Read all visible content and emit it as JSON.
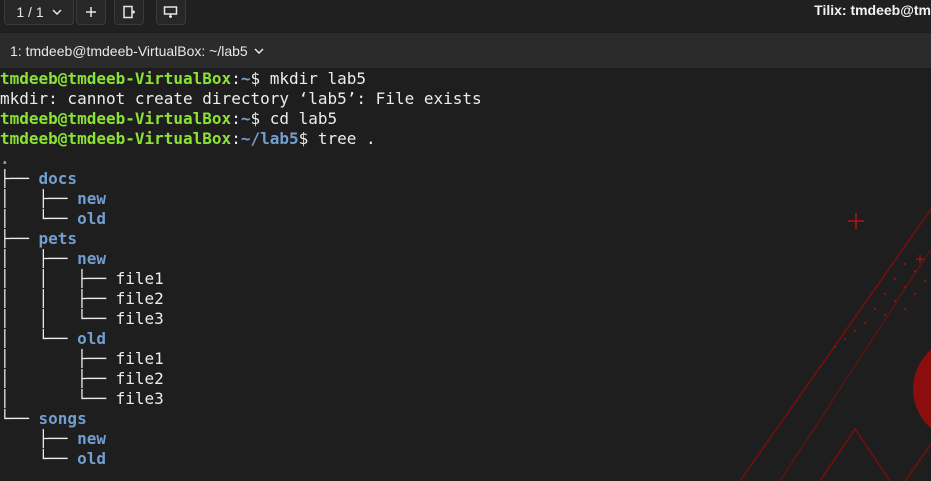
{
  "toolbar": {
    "pager": "1 / 1",
    "app_title": "Tilix: tmdeeb@tm"
  },
  "tab": {
    "label": "1: tmdeeb@tmdeeb-VirtualBox: ~/lab5"
  },
  "terminal": {
    "prompt_user": "tmdeeb@tmdeeb-VirtualBox",
    "lines": [
      {
        "path": "~",
        "cmd": "mkdir lab5"
      },
      {
        "output": "mkdir: cannot create directory ‘lab5’: File exists"
      },
      {
        "path": "~",
        "cmd": "cd lab5"
      },
      {
        "path": "~/lab5",
        "cmd": "tree ."
      }
    ],
    "tree": [
      {
        "branch": "",
        "name": ".",
        "dir": true
      },
      {
        "branch": "├── ",
        "name": "docs",
        "dir": true
      },
      {
        "branch": "│   ├── ",
        "name": "new",
        "dir": true
      },
      {
        "branch": "│   └── ",
        "name": "old",
        "dir": true
      },
      {
        "branch": "├── ",
        "name": "pets",
        "dir": true
      },
      {
        "branch": "│   ├── ",
        "name": "new",
        "dir": true
      },
      {
        "branch": "│   │   ├── ",
        "name": "file1",
        "dir": false
      },
      {
        "branch": "│   │   ├── ",
        "name": "file2",
        "dir": false
      },
      {
        "branch": "│   │   └── ",
        "name": "file3",
        "dir": false
      },
      {
        "branch": "│   └── ",
        "name": "old",
        "dir": true
      },
      {
        "branch": "│       ├── ",
        "name": "file1",
        "dir": false
      },
      {
        "branch": "│       ├── ",
        "name": "file2",
        "dir": false
      },
      {
        "branch": "│       └── ",
        "name": "file3",
        "dir": false
      },
      {
        "branch": "└── ",
        "name": "songs",
        "dir": true
      },
      {
        "branch": "    ├── ",
        "name": "new",
        "dir": true
      },
      {
        "branch": "    └── ",
        "name": "old",
        "dir": true
      }
    ]
  },
  "colors": {
    "user": "#8ae234",
    "path": "#729fcf",
    "background": "#1e1e1e",
    "accent_red": "#9b1111"
  },
  "icons": [
    "chevron-down-icon",
    "plus-icon",
    "split-right-icon",
    "split-down-icon"
  ]
}
